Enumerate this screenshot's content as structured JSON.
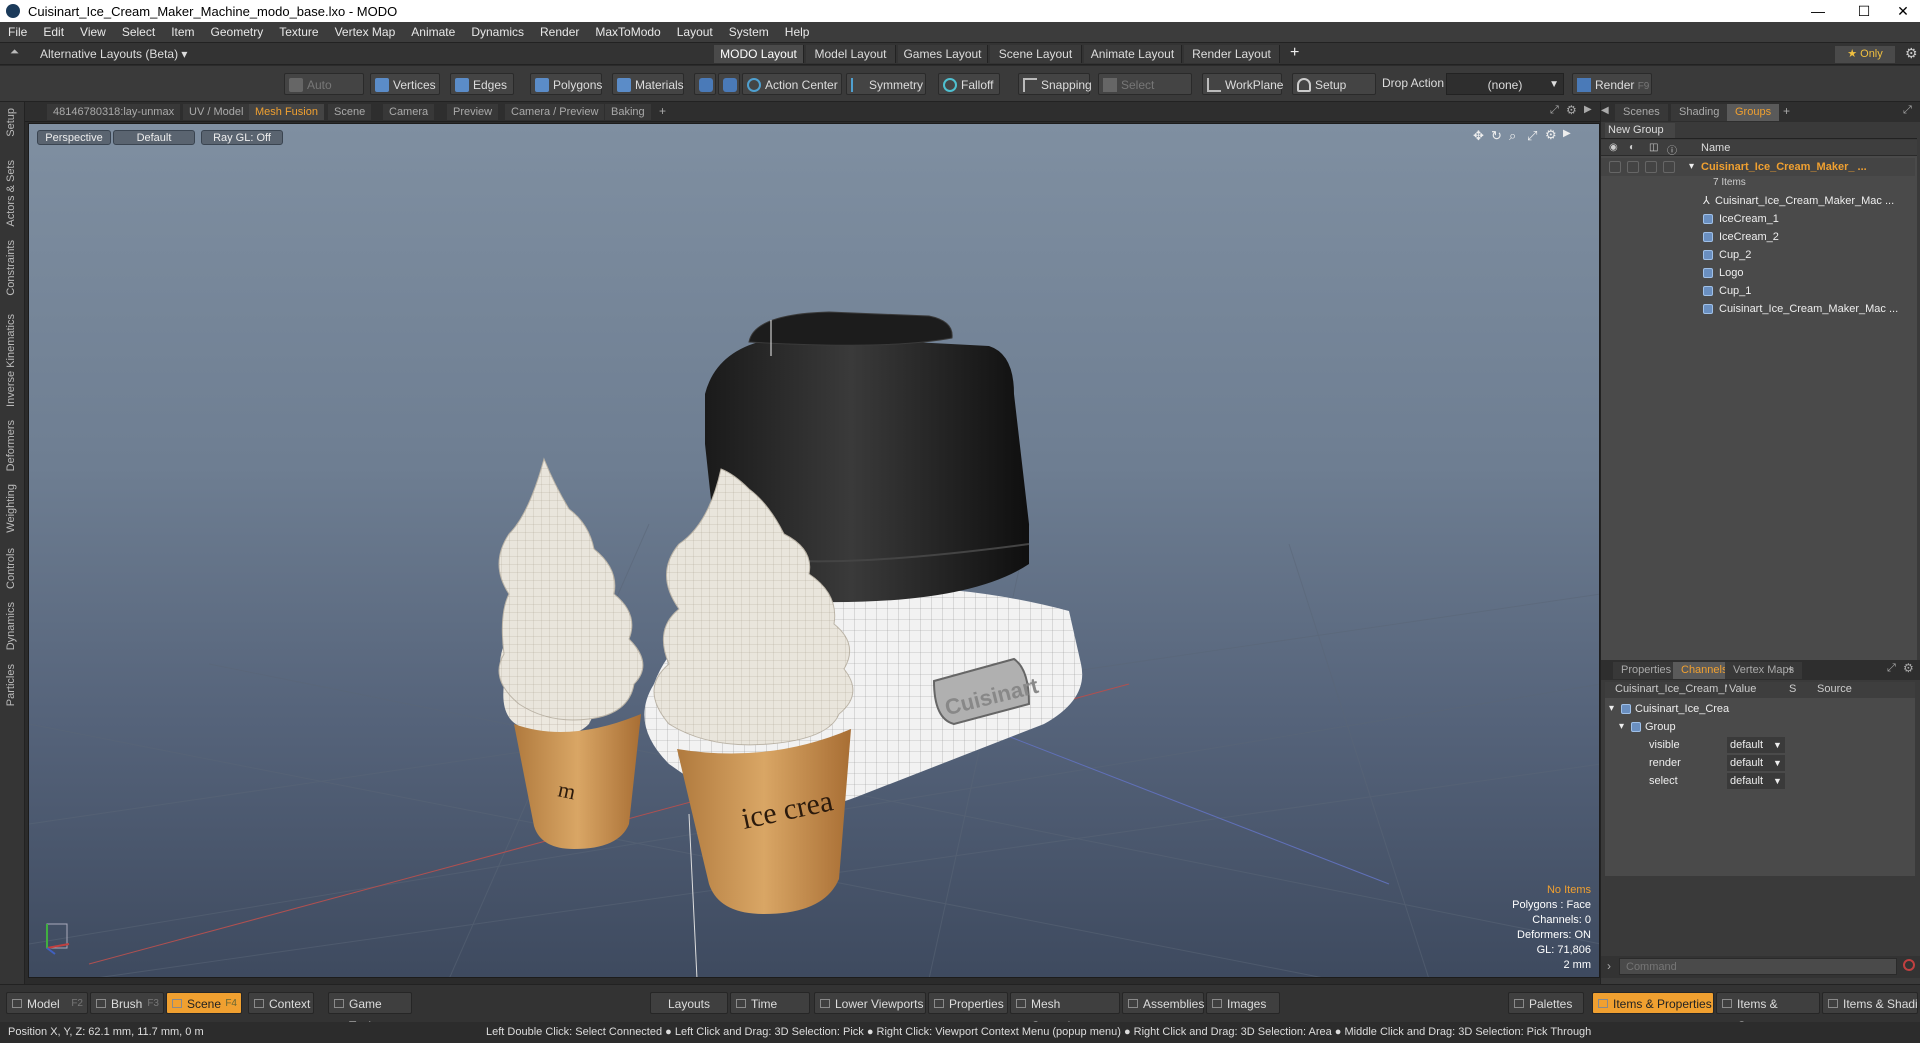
{
  "window": {
    "title": "Cuisinart_Ice_Cream_Maker_Machine_modo_base.lxo - MODO",
    "minimize": "—",
    "maximize": "☐",
    "close": "✕"
  },
  "menu": [
    "File",
    "Edit",
    "View",
    "Select",
    "Item",
    "Geometry",
    "Texture",
    "Vertex Map",
    "Animate",
    "Dynamics",
    "Render",
    "MaxToModo",
    "Layout",
    "System",
    "Help"
  ],
  "layouts": {
    "alt_label": "Alternative Layouts (Beta) ▾",
    "tabs": [
      "MODO Layout",
      "Model Layout",
      "Games Layout",
      "Scene Layout",
      "Animate Layout",
      "Render Layout"
    ],
    "add": "+",
    "only": "★  Only"
  },
  "toolbar": {
    "auto_select": "Auto Select",
    "vertices": "Vertices",
    "edges": "Edges",
    "polygons": "Polygons",
    "materials": "Materials",
    "action_center": "Action Center",
    "symmetry": "Symmetry",
    "falloff": "Falloff",
    "snapping": "Snapping",
    "select_through": "Select Through",
    "workplane": "WorkPlane",
    "setup_mode": "Setup Mode",
    "drop_action": "Drop Action",
    "drop_value": "(none)",
    "render": "Render",
    "render_key": "F9"
  },
  "left_tabs": [
    "Setup",
    "Actors & Sets",
    "Constraints",
    "Inverse Kinematics",
    "Deformers",
    "Weighting",
    "Controls",
    "Dynamics",
    "Particles"
  ],
  "viewport_tabs": [
    "48146780318:lay-unmax",
    "UV / Model",
    "Mesh Fusion",
    "Scene",
    "Camera",
    "Preview",
    "Camera / Preview",
    "Baking"
  ],
  "viewport": {
    "perspective": "Perspective",
    "shading": "Default",
    "raygl": "Ray GL: Off",
    "cup_text_front": "ice crea",
    "cup_text_back": "m",
    "brand": "Cuisinart",
    "hud": {
      "no_items": "No Items",
      "polygons": "Polygons : Face",
      "channels": "Channels: 0",
      "deformers": "Deformers: ON",
      "gl": "GL: 71,806",
      "unit": "2 mm"
    }
  },
  "groups_panel": {
    "tabs": [
      "Scenes",
      "Shading",
      "Groups"
    ],
    "new_group": "New Group",
    "col_name": "Name",
    "root": "Cuisinart_Ice_Cream_Maker_ ...",
    "count": "7 Items",
    "items": [
      "Cuisinart_Ice_Cream_Maker_Mac ...",
      "IceCream_1",
      "IceCream_2",
      "Cup_2",
      "Logo",
      "Cup_1",
      "Cuisinart_Ice_Cream_Maker_Mac ..."
    ]
  },
  "channels_panel": {
    "tabs": [
      "Properties",
      "Channels",
      "Vertex Maps"
    ],
    "head_name": "Cuisinart_Ice_Cream_M ...",
    "head_value": "Value",
    "head_s": "S",
    "head_source": "Source",
    "root": "Cuisinart_Ice_Crea ...",
    "group": "Group",
    "rows": [
      {
        "name": "visible",
        "value": "default"
      },
      {
        "name": "render",
        "value": "default"
      },
      {
        "name": "select",
        "value": "default"
      }
    ],
    "command_placeholder": "Command"
  },
  "bottom": {
    "model": "Model",
    "model_key": "F2",
    "brush": "Brush",
    "brush_key": "F3",
    "scene": "Scene",
    "scene_key": "F4",
    "context": "Context",
    "game_tools": "Game Tools",
    "layouts": "Layouts",
    "time": "Time",
    "lower_viewports": "Lower Viewports",
    "properties": "Properties",
    "mesh_operations": "Mesh Operations",
    "assemblies": "Assemblies",
    "images": "Images",
    "palettes": "Palettes",
    "items_properties": "Items & Properties",
    "items_groups": "Items & Groups",
    "items_shading": "Items & Shading"
  },
  "status": {
    "position": "Position X, Y, Z:   62.1 mm, 11.7 mm, 0 m",
    "hint": "Left Double Click: Select Connected ● Left Click and Drag: 3D Selection: Pick ● Right Click: Viewport Context Menu (popup menu) ● Right Click and Drag: 3D Selection: Area ● Middle Click and Drag: 3D Selection: Pick Through"
  },
  "colors": {
    "accent": "#f0a030",
    "panel": "#3a3a3a",
    "sky_top": "#7f8fa1",
    "sky_bottom": "#3e4a5f"
  }
}
